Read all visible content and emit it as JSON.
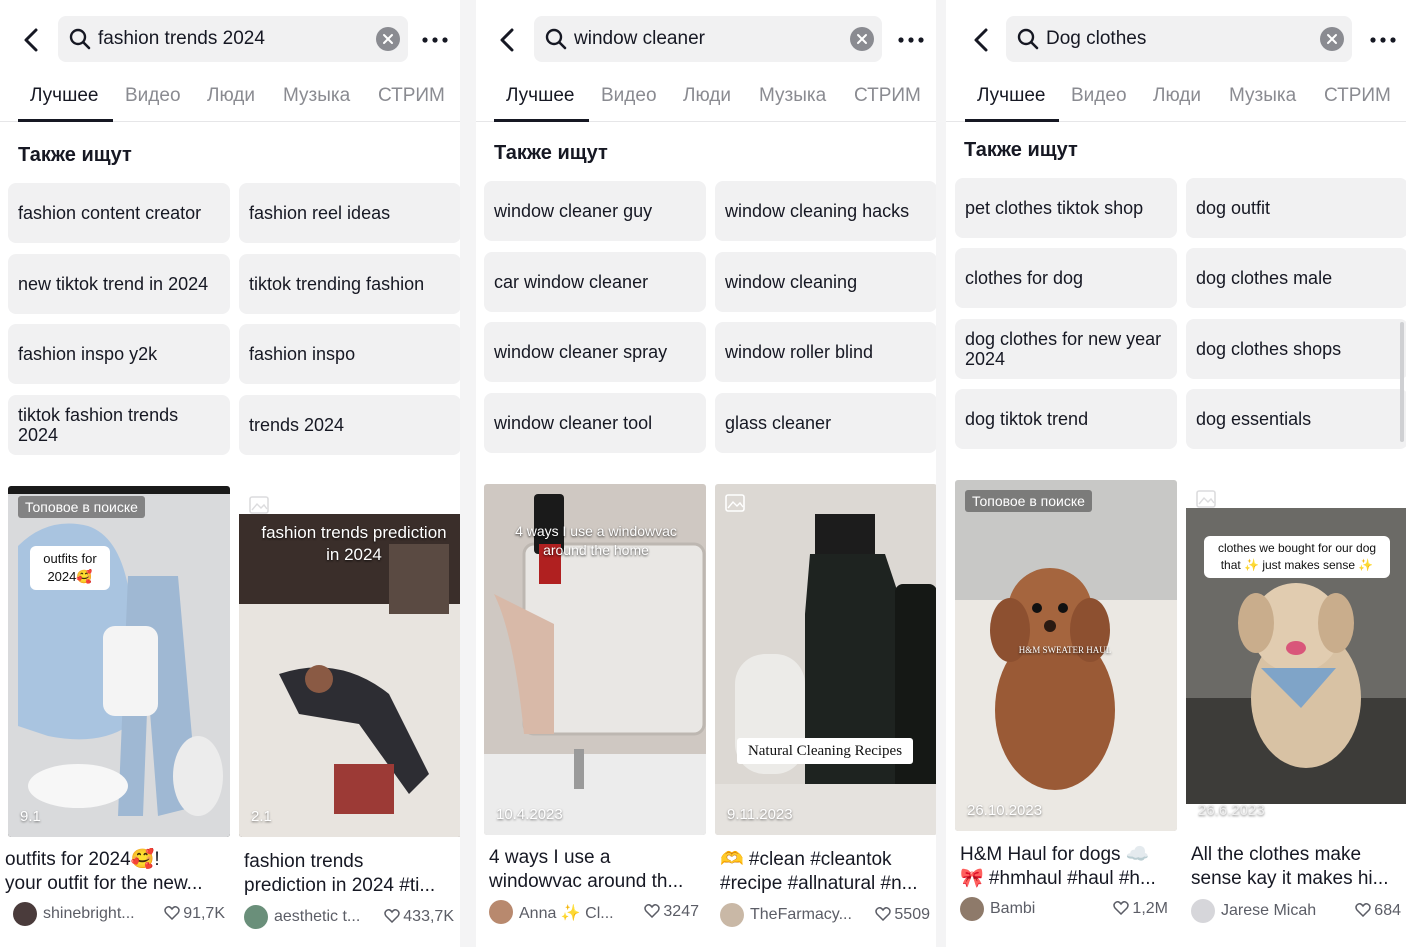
{
  "tabs": [
    "Лучшее",
    "Видео",
    "Люди",
    "Музыка",
    "СТРИМ"
  ],
  "also_search_title": "Также ищут",
  "panels": [
    {
      "query": "fashion trends 2024",
      "suggestions": [
        "fashion content creator",
        "fashion reel ideas",
        "new tiktok trend in 2024",
        "tiktok trending fashion",
        "fashion inspo y2k",
        "fashion inspo",
        "tiktok fashion trends 2024",
        "trends 2024"
      ],
      "cards": [
        {
          "badge": "Топовое в поиске",
          "date": "9.1",
          "overlay": "outfits for 2024🥰",
          "caption_l1": "outfits for 2024🥰!",
          "caption_l2": "your outfit for the new...",
          "author": "shinebright...",
          "likes": "91,7K"
        },
        {
          "date": "2.1",
          "overlay": "fashion trends prediction in 2024",
          "caption_l1": "fashion trends",
          "caption_l2": "prediction in 2024 #ti...",
          "author": "aesthetic t...",
          "likes": "433,7K"
        }
      ]
    },
    {
      "query": "window cleaner",
      "suggestions": [
        "window cleaner guy",
        "window cleaning hacks",
        "car window cleaner",
        "window cleaning",
        "window cleaner spray",
        "window roller blind",
        "window cleaner tool",
        "glass cleaner"
      ],
      "cards": [
        {
          "date": "10.4.2023",
          "overlay": "4 ways I use a windowvac around the home",
          "caption_l1": "4 ways I use a",
          "caption_l2": "windowvac around th...",
          "author": "Anna ✨ Cl...",
          "likes": "3247"
        },
        {
          "date": "9.11.2023",
          "overlay": "Natural Cleaning Recipes",
          "caption_l1": "🫶 #clean #cleantok",
          "caption_l2": "#recipe #allnatural #n...",
          "author": "TheFarmacy...",
          "likes": "5509"
        }
      ]
    },
    {
      "query": "Dog clothes",
      "suggestions": [
        "pet clothes tiktok shop",
        "dog outfit",
        "clothes for dog",
        "dog clothes male",
        "dog clothes for new year 2024",
        "dog clothes shops",
        "dog tiktok trend",
        "dog essentials"
      ],
      "cards": [
        {
          "badge": "Топовое в поиске",
          "date": "26.10.2023",
          "overlay": "H&M SWEATER HAUL",
          "caption_l1": "H&M Haul for dogs ☁️",
          "caption_l2": "🎀 #hmhaul #haul #h...",
          "author": "Bambi",
          "likes": "1,2M"
        },
        {
          "date": "26.6.2023",
          "overlay": "clothes we bought for our dog that ✨ just makes sense ✨",
          "caption_l1": "All the clothes make",
          "caption_l2": "sense kay it makes hi...",
          "author": "Jarese Micah",
          "likes": "684"
        }
      ]
    }
  ],
  "colors": {
    "chip_bg": "#f1f1f2",
    "text": "#161823",
    "muted": "#8a8b91"
  }
}
